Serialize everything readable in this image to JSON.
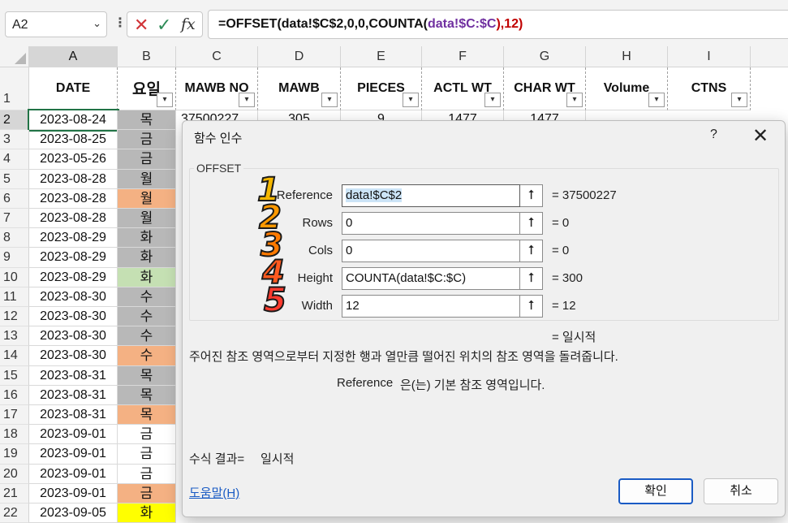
{
  "formula_bar": {
    "name_box": "A2",
    "formula_parts": [
      "=OFFSET(data!$C$2,0,0,",
      "COUNTA(",
      "data!$C:$C",
      "),12)"
    ]
  },
  "columns": [
    "A",
    "B",
    "C",
    "D",
    "E",
    "F",
    "G",
    "H",
    "I"
  ],
  "header_row": {
    "row_number": "1",
    "cells": [
      "DATE",
      "요일",
      "MAWB NO",
      "MAWB",
      "PIECES",
      "ACTL WT",
      "CHAR WT",
      "Volume",
      "CTNS"
    ]
  },
  "rows": [
    {
      "num": "2",
      "date": "2023-08-24",
      "day": "목",
      "day_color": "#b8b8b8",
      "partial": [
        "37500227",
        "305",
        "9",
        "1477",
        "1477"
      ]
    },
    {
      "num": "3",
      "date": "2023-08-25",
      "day": "금",
      "day_color": "#b8b8b8"
    },
    {
      "num": "4",
      "date": "2023-05-26",
      "day": "금",
      "day_color": "#b8b8b8"
    },
    {
      "num": "5",
      "date": "2023-08-28",
      "day": "월",
      "day_color": "#b8b8b8"
    },
    {
      "num": "6",
      "date": "2023-08-28",
      "day": "월",
      "day_color": "#f4b183"
    },
    {
      "num": "7",
      "date": "2023-08-28",
      "day": "월",
      "day_color": "#b8b8b8"
    },
    {
      "num": "8",
      "date": "2023-08-29",
      "day": "화",
      "day_color": "#b8b8b8"
    },
    {
      "num": "9",
      "date": "2023-08-29",
      "day": "화",
      "day_color": "#b8b8b8"
    },
    {
      "num": "10",
      "date": "2023-08-29",
      "day": "화",
      "day_color": "#c5e0b3"
    },
    {
      "num": "11",
      "date": "2023-08-30",
      "day": "수",
      "day_color": "#b8b8b8"
    },
    {
      "num": "12",
      "date": "2023-08-30",
      "day": "수",
      "day_color": "#b8b8b8"
    },
    {
      "num": "13",
      "date": "2023-08-30",
      "day": "수",
      "day_color": "#b8b8b8"
    },
    {
      "num": "14",
      "date": "2023-08-30",
      "day": "수",
      "day_color": "#f4b183"
    },
    {
      "num": "15",
      "date": "2023-08-31",
      "day": "목",
      "day_color": "#b8b8b8"
    },
    {
      "num": "16",
      "date": "2023-08-31",
      "day": "목",
      "day_color": "#b8b8b8"
    },
    {
      "num": "17",
      "date": "2023-08-31",
      "day": "목",
      "day_color": "#f4b183"
    },
    {
      "num": "18",
      "date": "2023-09-01",
      "day": "금",
      "day_color": "#ffffff"
    },
    {
      "num": "19",
      "date": "2023-09-01",
      "day": "금",
      "day_color": "#ffffff"
    },
    {
      "num": "20",
      "date": "2023-09-01",
      "day": "금",
      "day_color": "#ffffff"
    },
    {
      "num": "21",
      "date": "2023-09-01",
      "day": "금",
      "day_color": "#f4b183"
    },
    {
      "num": "22",
      "date": "2023-09-05",
      "day": "화",
      "day_color": "#ffff00"
    }
  ],
  "dialog": {
    "title": "함수 인수",
    "help_glyph": "?",
    "close_glyph": "✕",
    "function_name": "OFFSET",
    "args": [
      {
        "badge": "1",
        "label": "Reference",
        "value": "data!$C$2",
        "result": "=  37500227"
      },
      {
        "badge": "2",
        "label": "Rows",
        "value": "0",
        "result": "=  0"
      },
      {
        "badge": "3",
        "label": "Cols",
        "value": "0",
        "result": "=  0"
      },
      {
        "badge": "4",
        "label": "Height",
        "value": "COUNTA(data!$C:$C)",
        "result": "=  300"
      },
      {
        "badge": "5",
        "label": "Width",
        "value": "12",
        "result": "=  12"
      }
    ],
    "formula_value": "=  일시적",
    "description": "주어진 참조 영역으로부터 지정한 행과 열만큼 떨어진 위치의 참조 영역을 돌려줍니다.",
    "arg_desc_name": "Reference",
    "arg_desc_text": "은(는) 기본 참조 영역입니다.",
    "result_label": "수식 결과=",
    "result_value": "일시적",
    "help_link": "도움말(H)",
    "ok_label": "확인",
    "cancel_label": "취소"
  }
}
